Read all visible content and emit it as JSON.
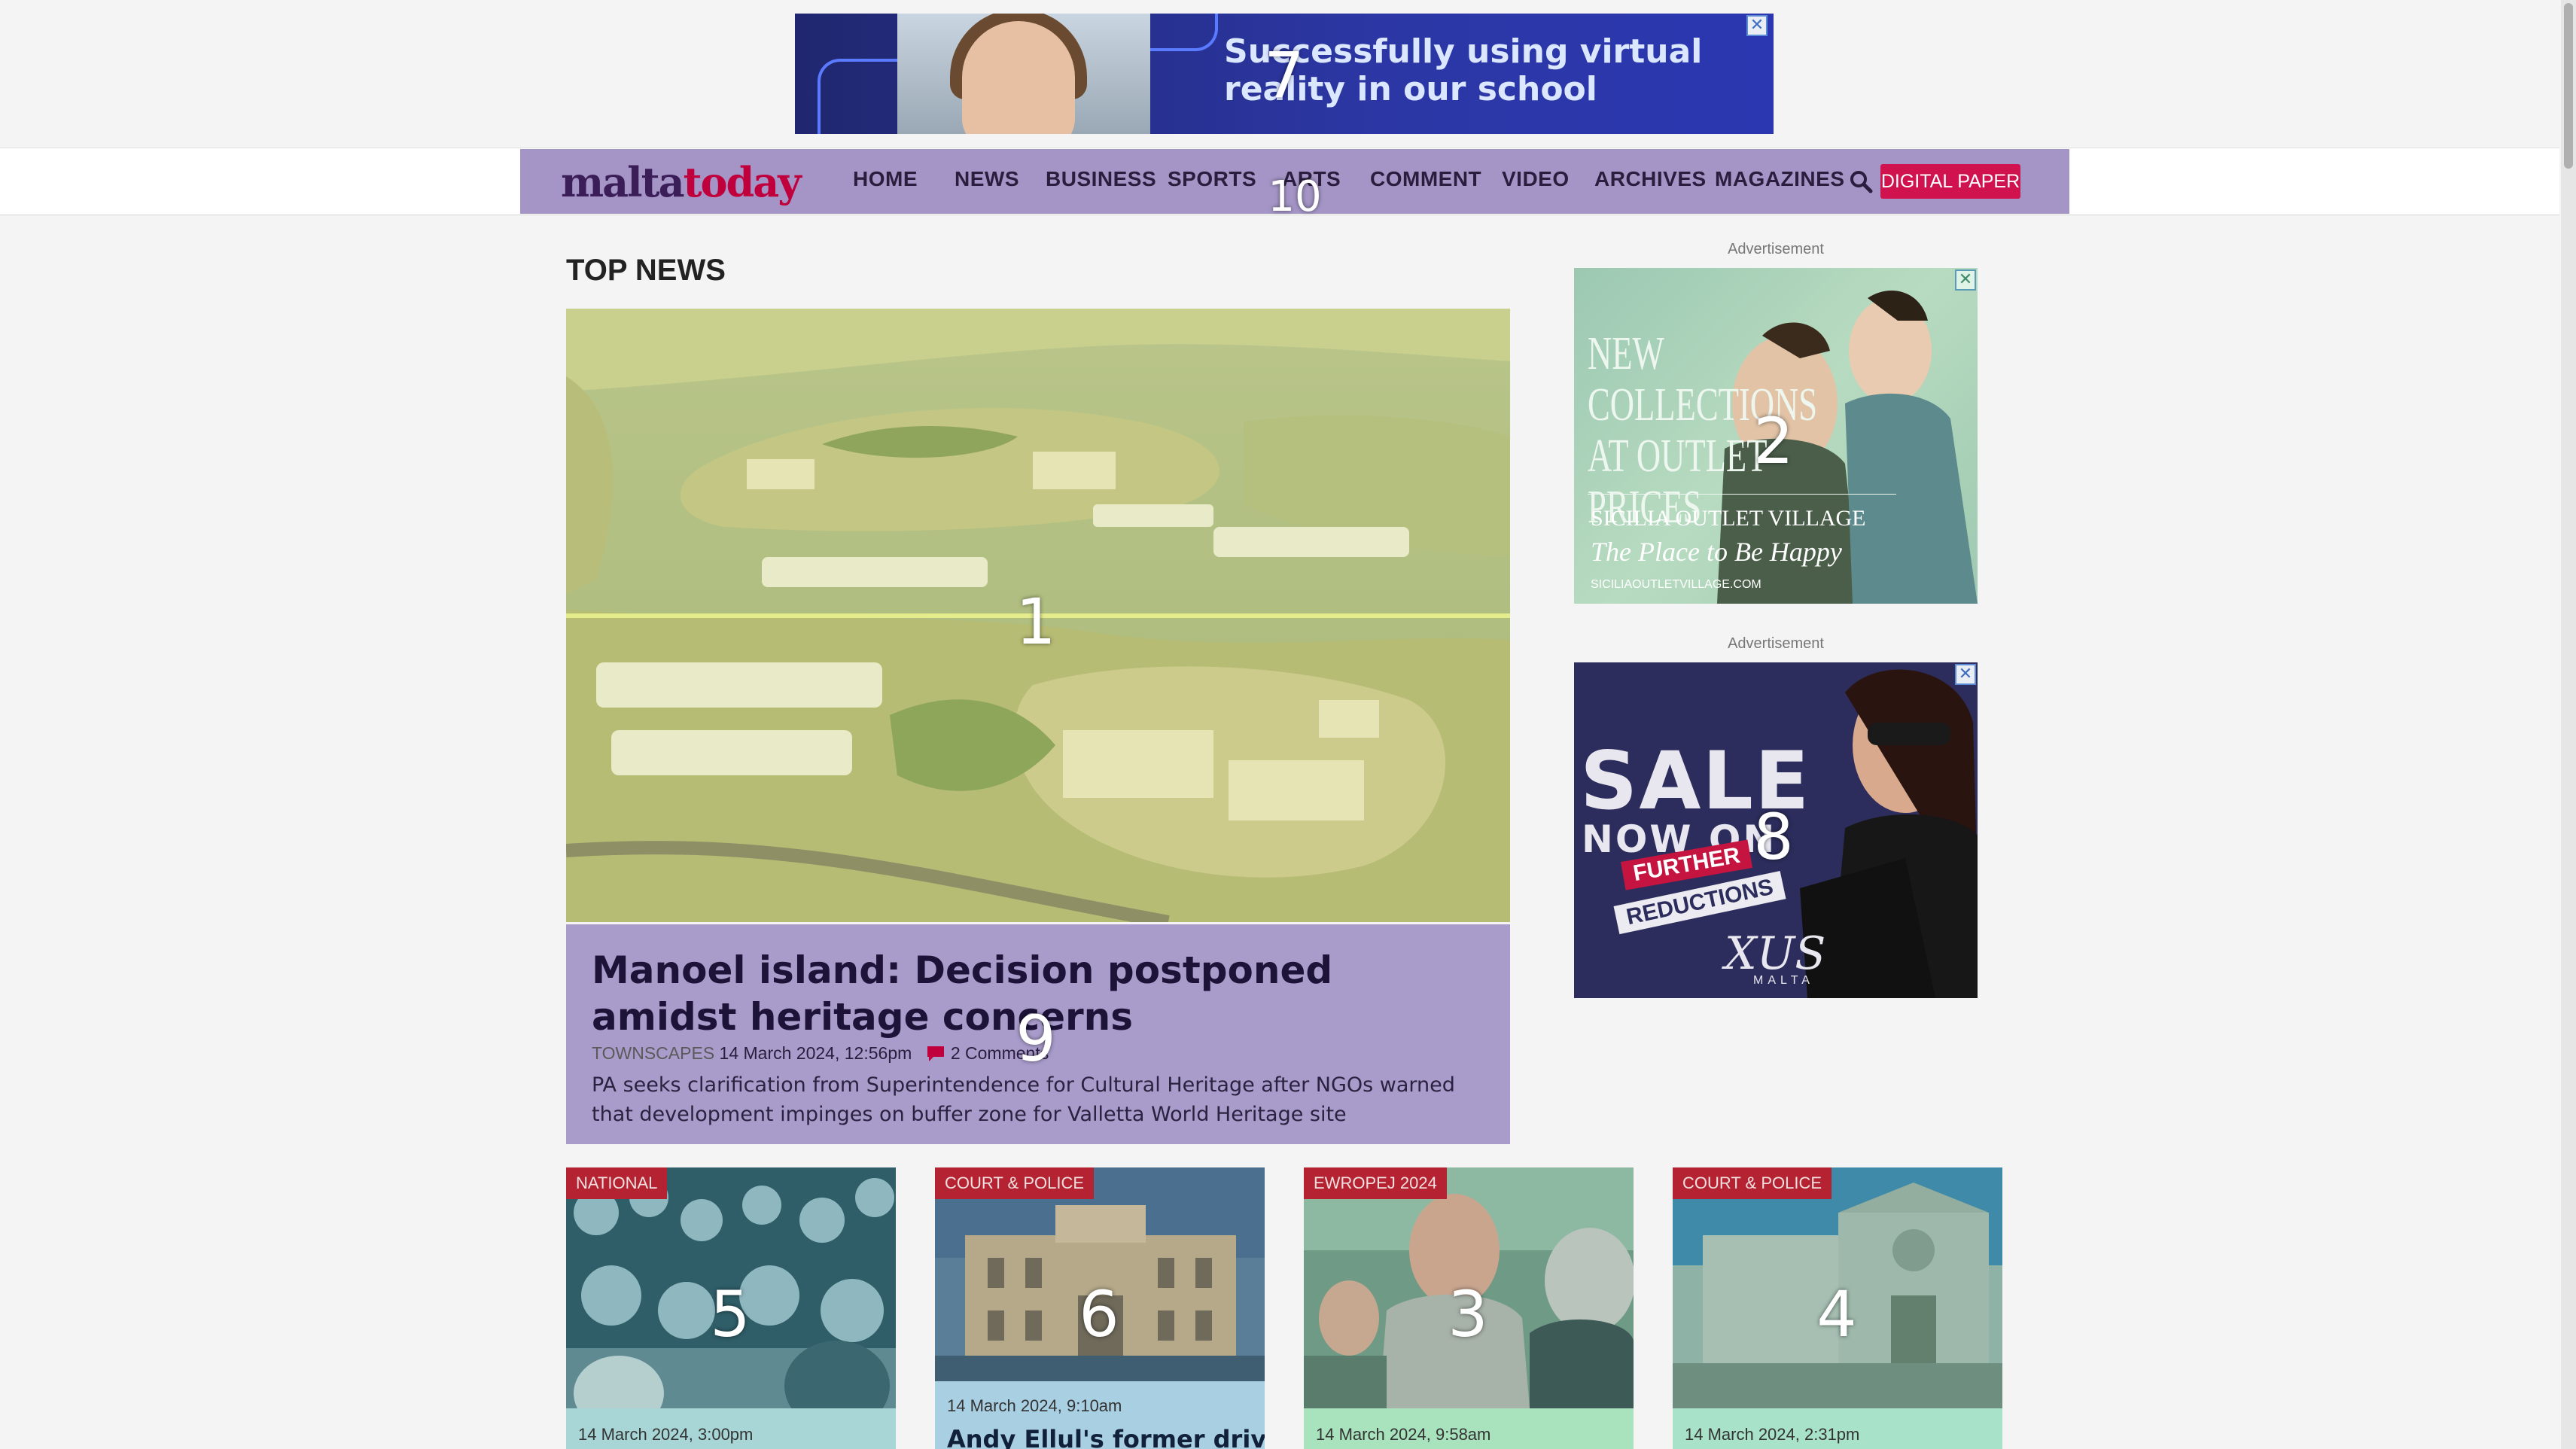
{
  "top_ad": {
    "text": "Successfully using virtual reality in our school",
    "close": "✕",
    "overlay_number": "7"
  },
  "nav": {
    "logo_part1": "malta",
    "logo_part2": "today",
    "items": [
      "HOME",
      "NEWS",
      "BUSINESS",
      "SPORTS",
      "ARTS",
      "COMMENT",
      "VIDEO",
      "ARCHIVES",
      "MAGAZINES"
    ],
    "digital_paper": "DIGITAL PAPER",
    "overlay_number": "10"
  },
  "top_news": {
    "section_title": "TOP NEWS",
    "hero": {
      "title": "Manoel island: Decision postponed amidst heritage concerns",
      "category": "TOWNSCAPES",
      "date": "14 March 2024, 12:56pm",
      "comments": "2 Comments",
      "description": "PA seeks clarification from Superintendence for Cultural Heritage after NGOs warned that development impinges on buffer zone for Valletta World Heritage site",
      "image_overlay_number": "1",
      "caption_overlay_number": "9"
    }
  },
  "side_ads": [
    {
      "label": "Advertisement",
      "line1": "NEW",
      "line2": "COLLECTIONS",
      "line3": "AT OUTLET PRICES",
      "brand": "SICILIA OUTLET VILLAGE",
      "tagline": "The Place to Be Happy",
      "url": "SICILIAOUTLETVILLAGE.COM",
      "overlay_number": "2"
    },
    {
      "label": "Advertisement",
      "line1": "SALE",
      "line2": "NOW ON",
      "badge1": "FURTHER",
      "badge2": "REDUCTIONS",
      "brand": "XUS",
      "brand_sub": "MALTA",
      "overlay_number": "8"
    }
  ],
  "cards": [
    {
      "tag": "NATIONAL",
      "date": "14 March 2024, 3:00pm",
      "title": "",
      "overlay_number": "5",
      "info_color": "#a8d6d6"
    },
    {
      "tag": "COURT & POLICE",
      "date": "14 March 2024, 9:10am",
      "title": "Andy Ellul's former driver",
      "overlay_number": "6",
      "info_color": "#a9cfe3"
    },
    {
      "tag": "EWROPEJ 2024",
      "date": "14 March 2024, 9:58am",
      "title": "",
      "overlay_number": "3",
      "info_color": "#a8e3bd"
    },
    {
      "tag": "COURT & POLICE",
      "date": "14 March 2024, 2:31pm",
      "title": "",
      "overlay_number": "4",
      "info_color": "#a8e3c9"
    }
  ]
}
